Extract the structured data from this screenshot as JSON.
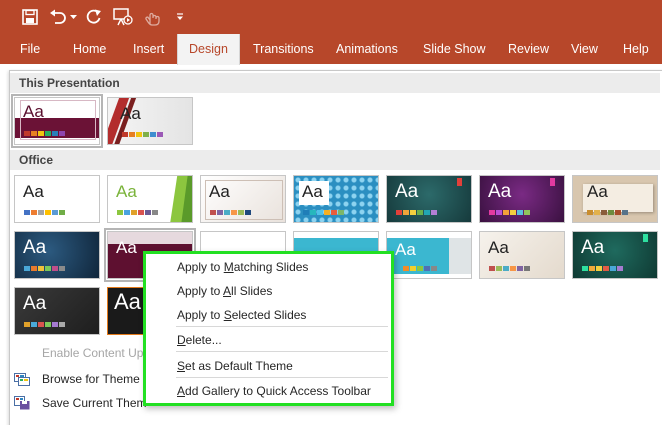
{
  "colors": {
    "brand": "#b7472a",
    "highlight": "#22e022"
  },
  "qat": {
    "icons": [
      "save-icon",
      "undo-icon",
      "redo-icon",
      "slideshow-from-start-icon",
      "touch-mode-icon",
      "customize-qat-icon"
    ]
  },
  "tabs": [
    "File",
    "Home",
    "Insert",
    "Design",
    "Transitions",
    "Animations",
    "Slide Show",
    "Review",
    "View",
    "Help"
  ],
  "gallery": {
    "section_this_presentation": "This Presentation",
    "section_office": "Office",
    "thumb_text": "Aa"
  },
  "bottom_menu": {
    "enable_content": "Enable Content Up",
    "browse": "Browse for Theme",
    "save": "Save Current Them"
  },
  "context_menu": {
    "apply_matching_pre": "Apply to ",
    "apply_matching_key": "M",
    "apply_matching_post": "atching Slides",
    "apply_all_pre": "Apply to ",
    "apply_all_key": "A",
    "apply_all_post": "ll Slides",
    "apply_selected_pre": "Apply to ",
    "apply_selected_key": "S",
    "apply_selected_post": "elected Slides",
    "delete_key": "D",
    "delete_post": "elete...",
    "default_key": "S",
    "default_post": "et as Default Theme",
    "add_gallery_key": "A",
    "add_gallery_post": "dd Gallery to Quick Access Toolbar"
  }
}
